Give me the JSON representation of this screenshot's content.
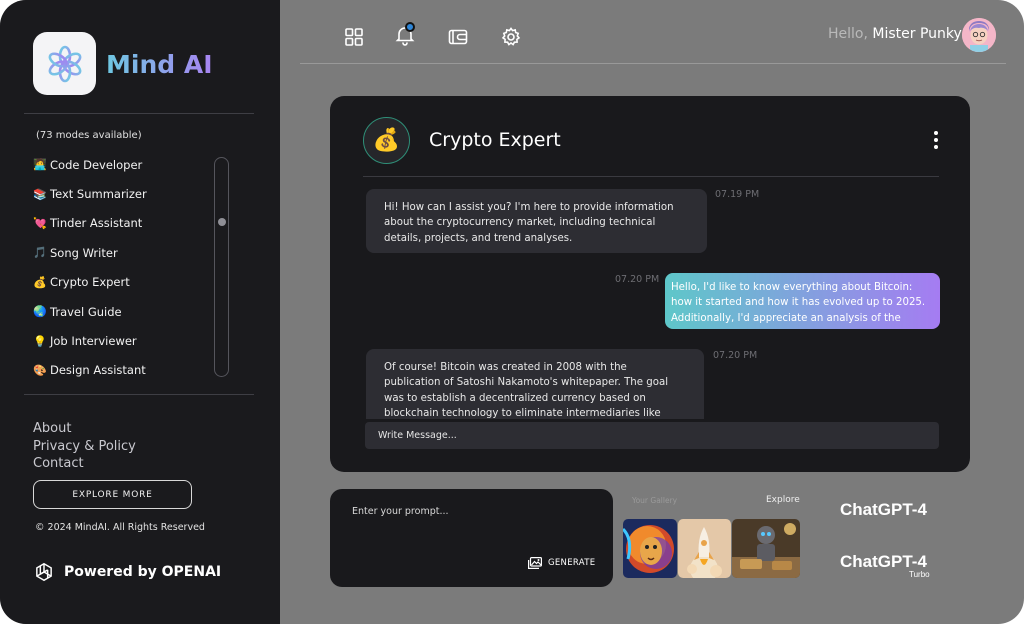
{
  "brand": {
    "name": "Mind AI"
  },
  "sidebar": {
    "modes_count": "(73 modes available)",
    "modes": [
      {
        "icon": "technologist-emoji",
        "emoji": "🧑‍💻",
        "label": "Code Developer"
      },
      {
        "icon": "books-emoji",
        "emoji": "📚",
        "label": "Text Summarizer"
      },
      {
        "icon": "heart-arrow-emoji",
        "emoji": "💘",
        "label": "Tinder Assistant"
      },
      {
        "icon": "music-notes-emoji",
        "emoji": "🎵",
        "label": "Song Writer"
      },
      {
        "icon": "money-bag-emoji",
        "emoji": "💰",
        "label": "Crypto Expert"
      },
      {
        "icon": "globe-emoji",
        "emoji": "🌏",
        "label": "Travel Guide"
      },
      {
        "icon": "lightbulb-emoji",
        "emoji": "💡",
        "label": "Job Interviewer"
      },
      {
        "icon": "palette-emoji",
        "emoji": "🎨",
        "label": "Design Assistant"
      }
    ],
    "links": {
      "about": "About",
      "privacy": "Privacy & Policy",
      "contact": "Contact"
    },
    "explore_button": "EXPLORE MORE",
    "copyright": "© 2024 MindAI. All Rights Reserved",
    "powered_by": "Powered by OPENAI"
  },
  "topbar": {
    "icons": [
      "grid-icon",
      "bell-icon",
      "wallet-icon",
      "gear-icon"
    ],
    "greeting": "Hello,",
    "user_name": "Mister Punky"
  },
  "chat": {
    "avatar_emoji": "💰",
    "title": "Crypto Expert",
    "messages": [
      {
        "sender": "bot",
        "text": "Hi! How can I assist you? I'm here to provide information about the cryptocurrency market, including technical details, projects, and trend analyses.",
        "time": "07.19 PM"
      },
      {
        "sender": "user",
        "text": "Hello, I'd like to know everything about Bitcoin: how it started and how it has evolved up to 2025. Additionally, I'd appreciate an analysis of the",
        "time": "07.20 PM"
      },
      {
        "sender": "bot",
        "text": "Of course! Bitcoin was created in 2008 with the publication of Satoshi Nakamoto's whitepaper. The goal was to establish a decentralized currency based on blockchain technology to eliminate intermediaries like banks. The first",
        "time": "07.20 PM"
      }
    ],
    "input_placeholder": "Write Message..."
  },
  "prompt": {
    "placeholder": "Enter your prompt...",
    "generate_label": "GENERATE"
  },
  "gallery": {
    "label": "Your Gallery",
    "explore": "Explore"
  },
  "models": {
    "primary": "ChatGPT-4",
    "secondary": "ChatGPT-4",
    "secondary_suffix": "Turbo"
  },
  "colors": {
    "sidebar_bg": "#1a1a1d",
    "panel_bg": "#19191c",
    "page_bg": "#7b7b7b",
    "accent_start": "#5ec7c9",
    "accent_end": "#a57cf2"
  }
}
